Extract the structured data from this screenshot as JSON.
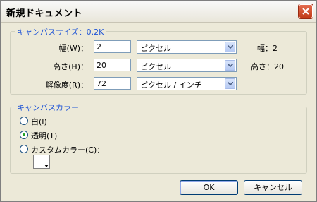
{
  "window": {
    "title": "新規ドキュメント"
  },
  "canvas_size": {
    "legend": "キャンバスサイズ：0.2K",
    "width": {
      "label": "幅(W)：",
      "value": "2",
      "unit": "ピクセル",
      "info": "幅：2"
    },
    "height": {
      "label": "高さ(H)：",
      "value": "20",
      "unit": "ピクセル",
      "info": "高さ：20"
    },
    "resolution": {
      "label": "解像度(R)：",
      "value": "72",
      "unit": "ピクセル / インチ"
    }
  },
  "canvas_color": {
    "legend": "キャンバスカラー",
    "options": [
      {
        "label": "白(I)",
        "selected": false
      },
      {
        "label": "透明(T)",
        "selected": true
      },
      {
        "label": "カスタムカラー(C)：",
        "selected": false
      }
    ],
    "custom_color": "#ffffff"
  },
  "buttons": {
    "ok": "OK",
    "cancel": "キャンセル"
  }
}
